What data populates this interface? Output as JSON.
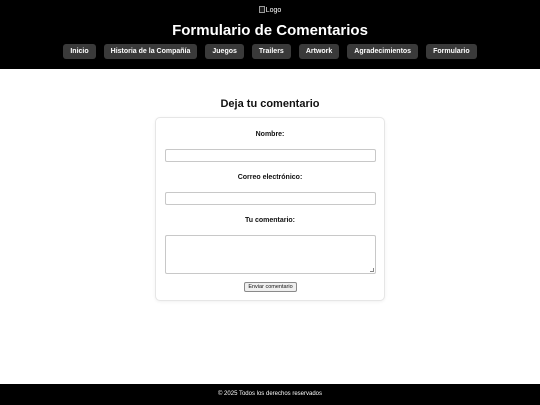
{
  "header": {
    "logo_alt": "Logo",
    "title": "Formulario de Comentarios",
    "nav": [
      {
        "label": "Inicio"
      },
      {
        "label": "Historia de la Compañía"
      },
      {
        "label": "Juegos"
      },
      {
        "label": "Trailers"
      },
      {
        "label": "Artwork"
      },
      {
        "label": "Agradecimientos"
      },
      {
        "label": "Formulario"
      }
    ]
  },
  "form": {
    "heading": "Deja tu comentario",
    "name_label": "Nombre:",
    "name_value": "",
    "email_label": "Correo electrónico:",
    "email_value": "",
    "comment_label": "Tu comentario:",
    "comment_value": "",
    "submit_label": "Enviar comentario"
  },
  "footer": {
    "text": "© 2025 Todos los derechos reservados"
  },
  "colors": {
    "header_bg": "#000000",
    "nav_item_bg": "#3a3a3a",
    "footer_bg": "#000000"
  }
}
